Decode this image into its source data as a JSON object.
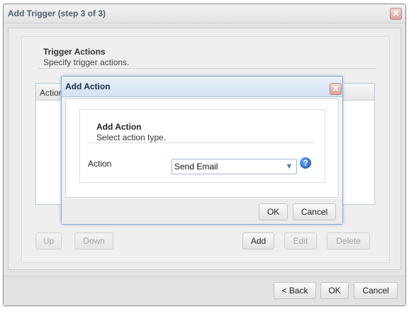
{
  "window": {
    "title": "Add Trigger (step 3 of 3)",
    "close_glyph": "✕"
  },
  "panel": {
    "title": "Trigger Actions",
    "subtitle": "Specify trigger actions."
  },
  "grid": {
    "columns": [
      "Action"
    ]
  },
  "grid_buttons": {
    "up": "Up",
    "down": "Down",
    "add": "Add",
    "edit": "Edit",
    "delete": "Delete"
  },
  "footer": {
    "back": "< Back",
    "ok": "OK",
    "cancel": "Cancel"
  },
  "modal": {
    "title": "Add Action",
    "close_glyph": "✕",
    "section_title": "Add Action",
    "section_subtitle": "Select action type.",
    "action_label": "Action",
    "action_value": "Send Email",
    "help_glyph": "?",
    "ok": "OK",
    "cancel": "Cancel"
  },
  "icons": {
    "window_close": "close-icon",
    "modal_close": "close-icon",
    "select_arrow": "chevron-down-icon",
    "help": "help-icon"
  }
}
